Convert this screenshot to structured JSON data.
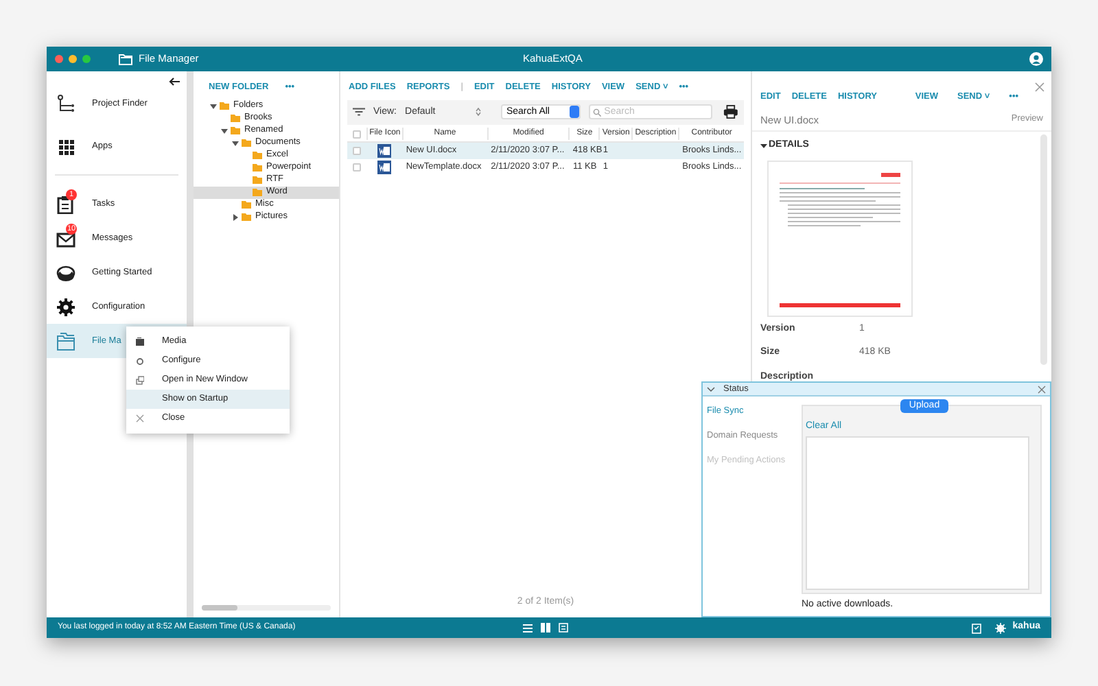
{
  "window": {
    "title": "File Manager",
    "center_title": "KahuaExtQA"
  },
  "nav": {
    "items": [
      {
        "kind": "tree",
        "label": "Project Finder",
        "selected": false
      },
      {
        "kind": "grid",
        "label": "Apps",
        "selected": false
      },
      {
        "kind": "clipboard",
        "label": "Tasks",
        "badge": "1",
        "selected": false
      },
      {
        "kind": "mail",
        "label": "Messages",
        "badge": "10",
        "selected": false
      },
      {
        "kind": "disc",
        "label": "Getting Started",
        "selected": false
      },
      {
        "kind": "gear",
        "label": "Configuration",
        "selected": false
      },
      {
        "kind": "folder",
        "label": "File Ma",
        "selected": true
      }
    ]
  },
  "context_menu": [
    {
      "kind": "media",
      "label": "Media",
      "selected": false
    },
    {
      "kind": "circle",
      "label": "Configure",
      "selected": false
    },
    {
      "kind": "window",
      "label": "Open in New Window",
      "selected": false
    },
    {
      "kind": "none",
      "label": "Show on Startup",
      "selected": true
    },
    {
      "kind": "close",
      "label": "Close",
      "selected": false
    }
  ],
  "tree": {
    "actions": [
      "NEW FOLDER",
      "•••"
    ],
    "nodes": [
      {
        "label": "Folders",
        "expanded": true,
        "selected": false,
        "children": [
          {
            "label": "Brooks",
            "selected": false
          },
          {
            "label": "Renamed",
            "expanded": true,
            "selected": false,
            "children": [
              {
                "label": "Documents",
                "expanded": true,
                "selected": false,
                "children": [
                  {
                    "label": "Excel",
                    "selected": false
                  },
                  {
                    "label": "Powerpoint",
                    "selected": false
                  },
                  {
                    "label": "RTF",
                    "selected": false
                  },
                  {
                    "label": "Word",
                    "selected": true
                  }
                ]
              },
              {
                "label": "Misc",
                "selected": false
              },
              {
                "label": "Pictures",
                "expanded": false,
                "selected": false
              }
            ]
          }
        ]
      }
    ]
  },
  "files": {
    "actions": [
      "ADD FILES",
      "REPORTS",
      "|",
      "EDIT",
      "DELETE",
      "HISTORY",
      "VIEW",
      "SEND ˅",
      "•••"
    ],
    "all_checked": false,
    "view_label": "View:",
    "view_value": "Default",
    "scope": "Search All",
    "search": {
      "placeholder": "Search"
    },
    "columns": [
      "File Icon",
      "Name",
      "Modified",
      "Size",
      "Version",
      "Description",
      "Contributor"
    ],
    "rows": [
      {
        "selected": true,
        "checked": false,
        "name": "New UI.docx",
        "modified": "2/11/2020 3:07 P...",
        "size": "418 KB",
        "version": "1",
        "contributor": "Brooks Linds..."
      },
      {
        "selected": false,
        "checked": false,
        "name": "NewTemplate.docx",
        "modified": "2/11/2020 3:07 P...",
        "size": "11 KB",
        "version": "1",
        "contributor": "Brooks Linds..."
      }
    ],
    "footer": "2 of 2 Item(s)"
  },
  "details": {
    "actions": [
      "EDIT",
      "DELETE",
      "HISTORY",
      "VIEW",
      "SEND ˅",
      "•••"
    ],
    "file_name": "New UI.docx",
    "preview": "Preview",
    "section": "DETAILS",
    "fields": [
      {
        "label": "Version",
        "value": "1"
      },
      {
        "label": "Size",
        "value": "418 KB"
      },
      {
        "label": "Description"
      }
    ]
  },
  "status_panel": {
    "title": "Status",
    "tabs": [
      {
        "label": "File Sync",
        "selected": true,
        "disabled": false
      },
      {
        "label": "Domain Requests",
        "selected": false,
        "disabled": false
      },
      {
        "label": "My Pending Actions",
        "selected": false,
        "disabled": true
      }
    ],
    "upload": "Upload",
    "clear_all": "Clear All",
    "message": "No active downloads."
  },
  "status_bar": {
    "message": "You last logged in today at 8:52 AM Eastern Time (US & Canada)",
    "logo": "kahua"
  }
}
